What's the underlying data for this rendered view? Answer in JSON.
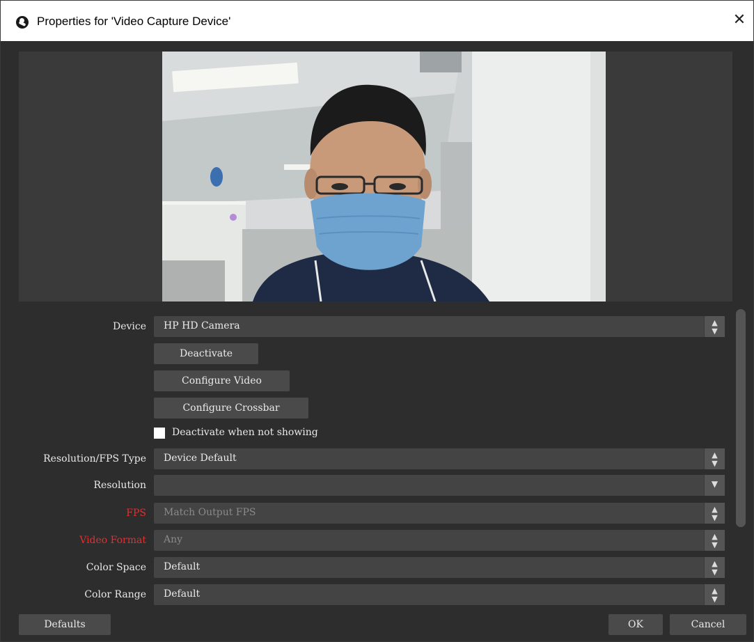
{
  "window": {
    "title": "Properties for 'Video Capture Device'",
    "close_glyph": "✕"
  },
  "form": {
    "device": {
      "label": "Device",
      "value": "HP HD Camera"
    },
    "deactivate_label": "Deactivate",
    "configure_video_label": "Configure Video",
    "configure_crossbar_label": "Configure Crossbar",
    "deactivate_when_not_showing": {
      "label": "Deactivate when not showing",
      "checked": false
    },
    "resolution_fps_type": {
      "label": "Resolution/FPS Type",
      "value": "Device Default"
    },
    "resolution": {
      "label": "Resolution",
      "value": ""
    },
    "fps": {
      "label": "FPS",
      "value": "Match Output FPS",
      "label_color": "#e03030"
    },
    "video_format": {
      "label": "Video Format",
      "value": "Any",
      "label_color": "#e03030"
    },
    "color_space": {
      "label": "Color Space",
      "value": "Default"
    },
    "color_range": {
      "label": "Color Range",
      "value": "Default"
    }
  },
  "footer": {
    "defaults_label": "Defaults",
    "ok_label": "OK",
    "cancel_label": "Cancel"
  },
  "icons": {
    "updown": "updown-arrows-icon",
    "down": "chevron-down-icon"
  }
}
